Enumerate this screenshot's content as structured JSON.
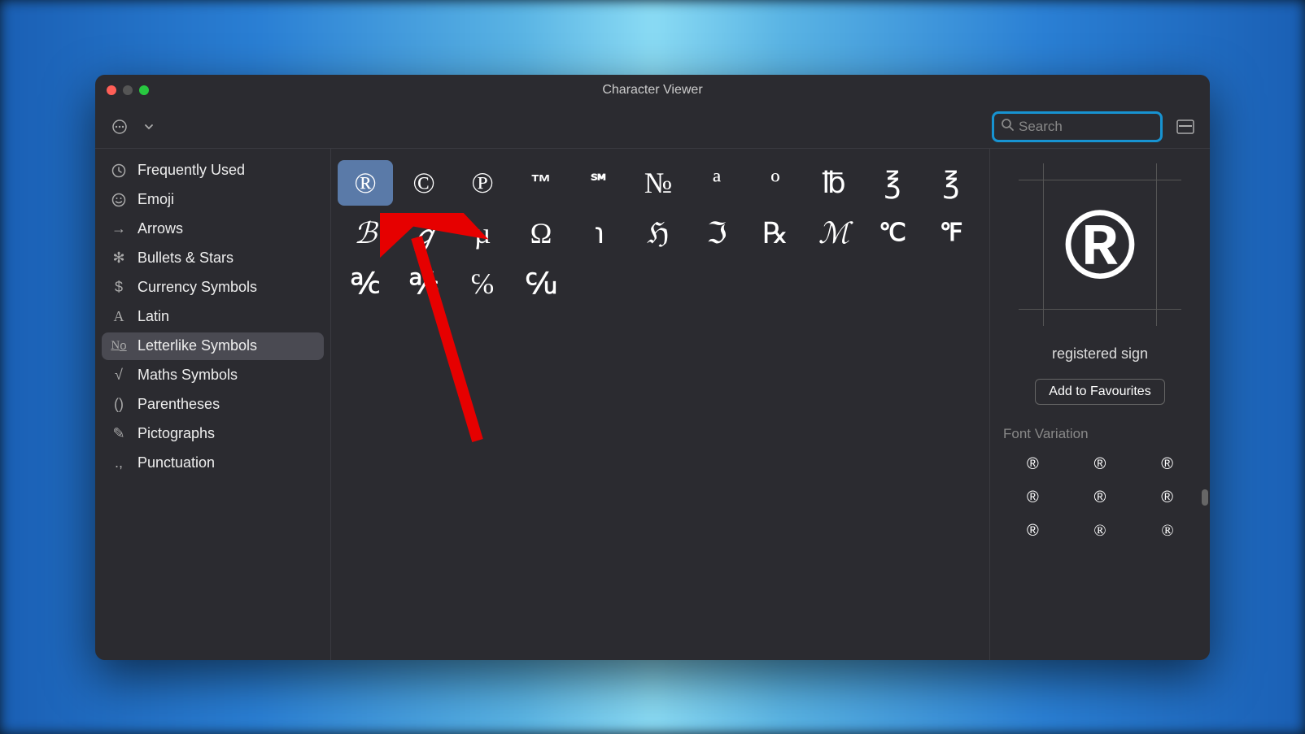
{
  "window": {
    "title": "Character Viewer"
  },
  "toolbar": {
    "search_placeholder": "Search"
  },
  "sidebar": {
    "items": [
      {
        "icon": "clock",
        "label": "Frequently Used"
      },
      {
        "icon": "smiley",
        "label": "Emoji"
      },
      {
        "icon": "arrow",
        "label": "Arrows"
      },
      {
        "icon": "star",
        "label": "Bullets & Stars"
      },
      {
        "icon": "dollar",
        "label": "Currency Symbols"
      },
      {
        "icon": "latin",
        "label": "Latin"
      },
      {
        "icon": "numero",
        "label": "Letterlike Symbols"
      },
      {
        "icon": "sqrt",
        "label": "Maths Symbols"
      },
      {
        "icon": "parens",
        "label": "Parentheses"
      },
      {
        "icon": "picto",
        "label": "Pictographs"
      },
      {
        "icon": "punct",
        "label": "Punctuation"
      }
    ],
    "selected_index": 6
  },
  "characters": {
    "rows": [
      [
        "®",
        "©",
        "℗",
        "™",
        "℠",
        "№",
        "ª",
        "º",
        "℔",
        "℥",
        "℥"
      ],
      [
        "ℬ",
        "ℊ",
        "µ",
        "Ω",
        "℩",
        "ℌ",
        "ℑ",
        "℞",
        "ℳ",
        "℃",
        "℉"
      ],
      [
        "℀",
        "℁",
        "℅",
        "℆"
      ]
    ],
    "selected": {
      "row": 0,
      "col": 0
    }
  },
  "detail": {
    "preview_char": "®",
    "name": "registered sign",
    "favourite_button": "Add to Favourites",
    "font_variation_label": "Font Variation",
    "variations": [
      "®",
      "®",
      "®",
      "®",
      "®",
      "®",
      "®",
      "®",
      "®"
    ]
  }
}
